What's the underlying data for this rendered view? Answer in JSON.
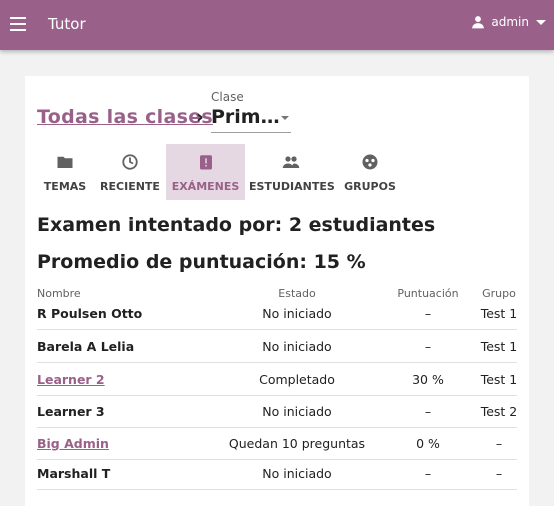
{
  "appbar": {
    "title": "Tutor",
    "user": "admin"
  },
  "breadcrumb": {
    "link": "Todas las clases",
    "separator": "›"
  },
  "class_select": {
    "label": "Clase",
    "value": "Prim…"
  },
  "tabs": [
    {
      "label": "TEMAS",
      "icon": "folder-icon"
    },
    {
      "label": "RECIENTE",
      "icon": "clock-icon"
    },
    {
      "label": "EXÁMENES",
      "icon": "exam-icon",
      "active": true
    },
    {
      "label": "ESTUDIANTES",
      "icon": "people-icon"
    },
    {
      "label": "GRUPOS",
      "icon": "groups-icon"
    }
  ],
  "summary": {
    "attempted": "Examen intentado por: 2 estudiantes",
    "average": "Promedio de puntuación: 15 %"
  },
  "table": {
    "headers": [
      "Nombre",
      "Estado",
      "Puntuación",
      "Grupo"
    ],
    "rows": [
      {
        "name": "R Poulsen Otto",
        "estado": "No iniciado",
        "puntuacion": "–",
        "grupo": "Test 1",
        "link": false
      },
      {
        "name": "Barela A Lelia",
        "estado": "No iniciado",
        "puntuacion": "–",
        "grupo": "Test 1",
        "link": false
      },
      {
        "name": "Learner 2",
        "estado": "Completado",
        "puntuacion": "30 %",
        "grupo": "Test 1",
        "link": true
      },
      {
        "name": "Learner 3",
        "estado": "No iniciado",
        "puntuacion": "–",
        "grupo": "Test 2",
        "link": false
      },
      {
        "name": "Big Admin",
        "estado": "Quedan 10 preguntas",
        "puntuacion": "0 %",
        "grupo": "–",
        "link": true
      },
      {
        "name": "Marshall T",
        "estado": "No iniciado",
        "puntuacion": "–",
        "grupo": "–",
        "link": false
      }
    ]
  },
  "colors": {
    "brand": "#996189",
    "active_tab_bg": "#e6d8e2"
  }
}
